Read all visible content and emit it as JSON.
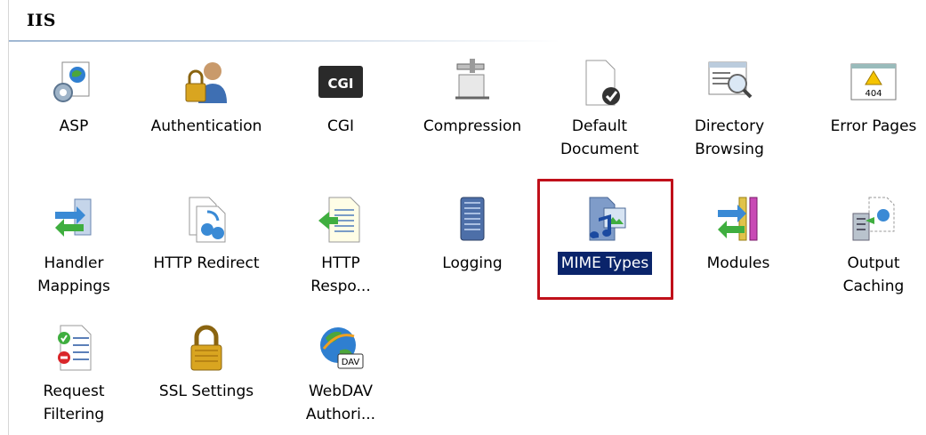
{
  "header": {
    "title": "IIS"
  },
  "features": [
    {
      "label": "ASP",
      "icon": "asp-icon"
    },
    {
      "label": "Authentication",
      "icon": "authentication-icon"
    },
    {
      "label": "CGI",
      "icon": "cgi-icon",
      "icon_text": "CGI"
    },
    {
      "label": "Compression",
      "icon": "compression-icon"
    },
    {
      "label": "Default\nDocument",
      "icon": "default-document-icon"
    },
    {
      "label": "Directory\nBrowsing",
      "icon": "directory-browsing-icon"
    },
    {
      "label": "Error Pages",
      "icon": "error-pages-icon",
      "icon_text": "404"
    },
    {
      "label": "Handler\nMappings",
      "icon": "handler-mappings-icon"
    },
    {
      "label": "HTTP Redirect",
      "icon": "http-redirect-icon"
    },
    {
      "label": "HTTP\nRespo...",
      "icon": "http-response-headers-icon"
    },
    {
      "label": "Logging",
      "icon": "logging-icon"
    },
    {
      "label": "MIME Types",
      "icon": "mime-types-icon",
      "selected": true
    },
    {
      "label": "Modules",
      "icon": "modules-icon"
    },
    {
      "label": "Output\nCaching",
      "icon": "output-caching-icon"
    },
    {
      "label": "Request\nFiltering",
      "icon": "request-filtering-icon"
    },
    {
      "label": "SSL Settings",
      "icon": "ssl-settings-icon"
    },
    {
      "label": "WebDAV\nAuthori...",
      "icon": "webdav-authoring-icon",
      "icon_text": "DAV"
    }
  ],
  "colors": {
    "selection_bg": "#0a246a",
    "highlight_border": "#c0101a"
  }
}
